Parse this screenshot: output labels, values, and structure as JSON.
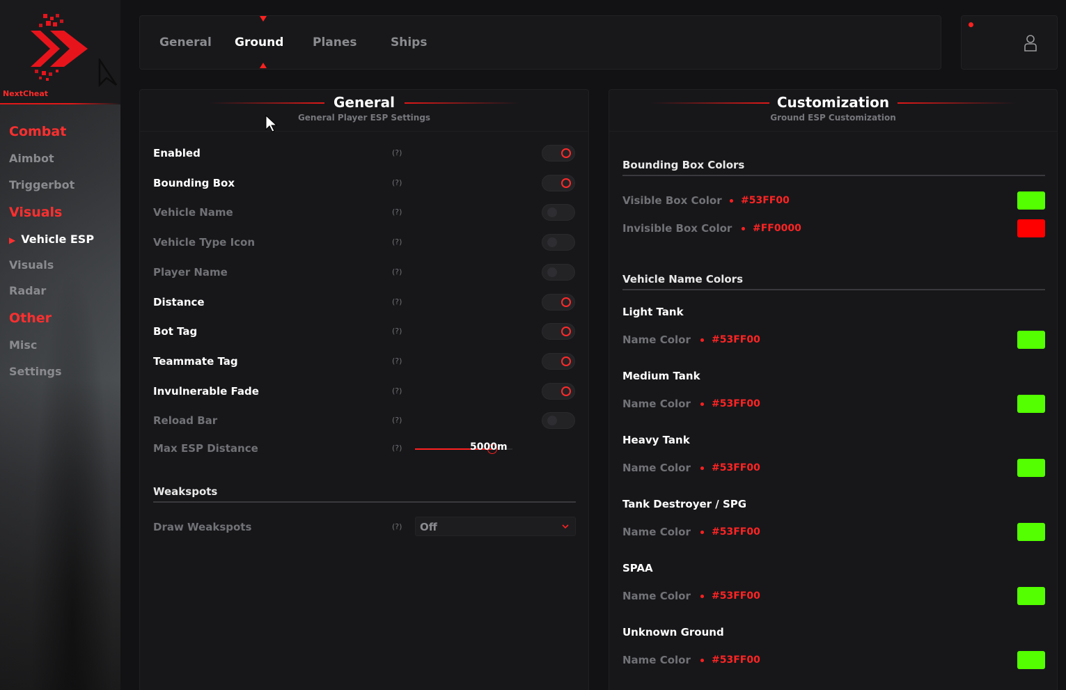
{
  "brand": {
    "name": "NextCheat",
    "accent": "#ff2020"
  },
  "sidebar": {
    "sections": [
      {
        "label": "Combat",
        "items": [
          {
            "label": "Aimbot",
            "active": false
          },
          {
            "label": "Triggerbot",
            "active": false
          }
        ]
      },
      {
        "label": "Visuals",
        "items": [
          {
            "label": "Vehicle ESP",
            "active": true
          },
          {
            "label": "Visuals",
            "active": false
          },
          {
            "label": "Radar",
            "active": false
          }
        ]
      },
      {
        "label": "Other",
        "items": [
          {
            "label": "Misc",
            "active": false
          },
          {
            "label": "Settings",
            "active": false
          }
        ]
      }
    ]
  },
  "tabs": [
    {
      "label": "General",
      "active": false
    },
    {
      "label": "Ground",
      "active": true
    },
    {
      "label": "Planes",
      "active": false
    },
    {
      "label": "Ships",
      "active": false
    }
  ],
  "user": {
    "icon": "user-icon",
    "status_color": "#ff2020"
  },
  "general_panel": {
    "title": "General",
    "subtitle": "General Player ESP Settings",
    "help_text": "(?)",
    "options": [
      {
        "label": "Enabled",
        "on": true
      },
      {
        "label": "Bounding Box",
        "on": true
      },
      {
        "label": "Vehicle Name",
        "on": false
      },
      {
        "label": "Vehicle Type Icon",
        "on": false
      },
      {
        "label": "Player Name",
        "on": false
      },
      {
        "label": "Distance",
        "on": true
      },
      {
        "label": "Bot Tag",
        "on": true
      },
      {
        "label": "Teammate Tag",
        "on": true
      },
      {
        "label": "Invulnerable Fade",
        "on": true
      },
      {
        "label": "Reload Bar",
        "on": false
      }
    ],
    "max_distance": {
      "label": "Max ESP Distance",
      "value_text": "5000m",
      "fill_fraction": 0.79
    },
    "weakspots": {
      "section": "Weakspots",
      "draw_label": "Draw Weakspots",
      "selected": "Off"
    }
  },
  "customization_panel": {
    "title": "Customization",
    "subtitle": "Ground ESP Customization",
    "bounding_section": "Bounding Box Colors",
    "bounding_colors": [
      {
        "label": "Visible Box Color",
        "hex": "#53FF00",
        "swatch": "#53ff00"
      },
      {
        "label": "Invisible Box Color",
        "hex": "#FF0000",
        "swatch": "#ff0000"
      }
    ],
    "name_section": "Vehicle Name Colors",
    "vehicles": [
      {
        "name": "Light Tank",
        "color_label": "Name Color",
        "hex": "#53FF00",
        "swatch": "#53ff00"
      },
      {
        "name": "Medium Tank",
        "color_label": "Name Color",
        "hex": "#53FF00",
        "swatch": "#53ff00"
      },
      {
        "name": "Heavy Tank",
        "color_label": "Name Color",
        "hex": "#53FF00",
        "swatch": "#53ff00"
      },
      {
        "name": "Tank Destroyer / SPG",
        "color_label": "Name Color",
        "hex": "#53FF00",
        "swatch": "#53ff00"
      },
      {
        "name": "SPAA",
        "color_label": "Name Color",
        "hex": "#53FF00",
        "swatch": "#53ff00"
      },
      {
        "name": "Unknown Ground",
        "color_label": "Name Color",
        "hex": "#53FF00",
        "swatch": "#53ff00"
      }
    ]
  }
}
